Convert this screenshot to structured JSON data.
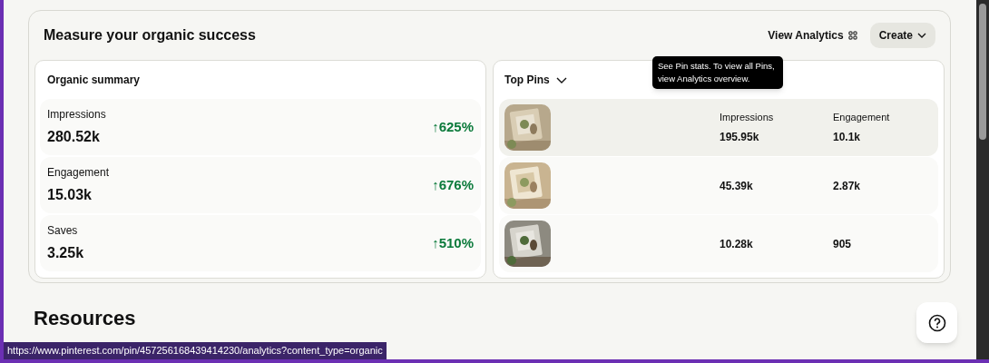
{
  "section": {
    "title": "Measure your organic success",
    "view_analytics": "View Analytics",
    "create_button": "Create"
  },
  "summary": {
    "title": "Organic summary",
    "metrics": [
      {
        "label": "Impressions",
        "value": "280.52k",
        "change": "↑625%"
      },
      {
        "label": "Engagement",
        "value": "15.03k",
        "change": "↑676%"
      },
      {
        "label": "Saves",
        "value": "3.25k",
        "change": "↑510%"
      }
    ]
  },
  "top_pins": {
    "title": "Top Pins",
    "tooltip": "See Pin stats. To view all Pins, view Analytics overview.",
    "pins": [
      {
        "hovered": true,
        "impressions_label": "Impressions",
        "impressions": "195.95k",
        "engagement_label": "Engagement",
        "engagement": "10.1k"
      },
      {
        "hovered": false,
        "impressions": "45.39k",
        "engagement": "2.87k"
      },
      {
        "hovered": false,
        "impressions": "10.28k",
        "engagement": "905"
      }
    ]
  },
  "resources": {
    "title": "Resources"
  },
  "status_bar": {
    "url": "https://www.pinterest.com/pin/457256168439414230/analytics?content_type=organic"
  }
}
